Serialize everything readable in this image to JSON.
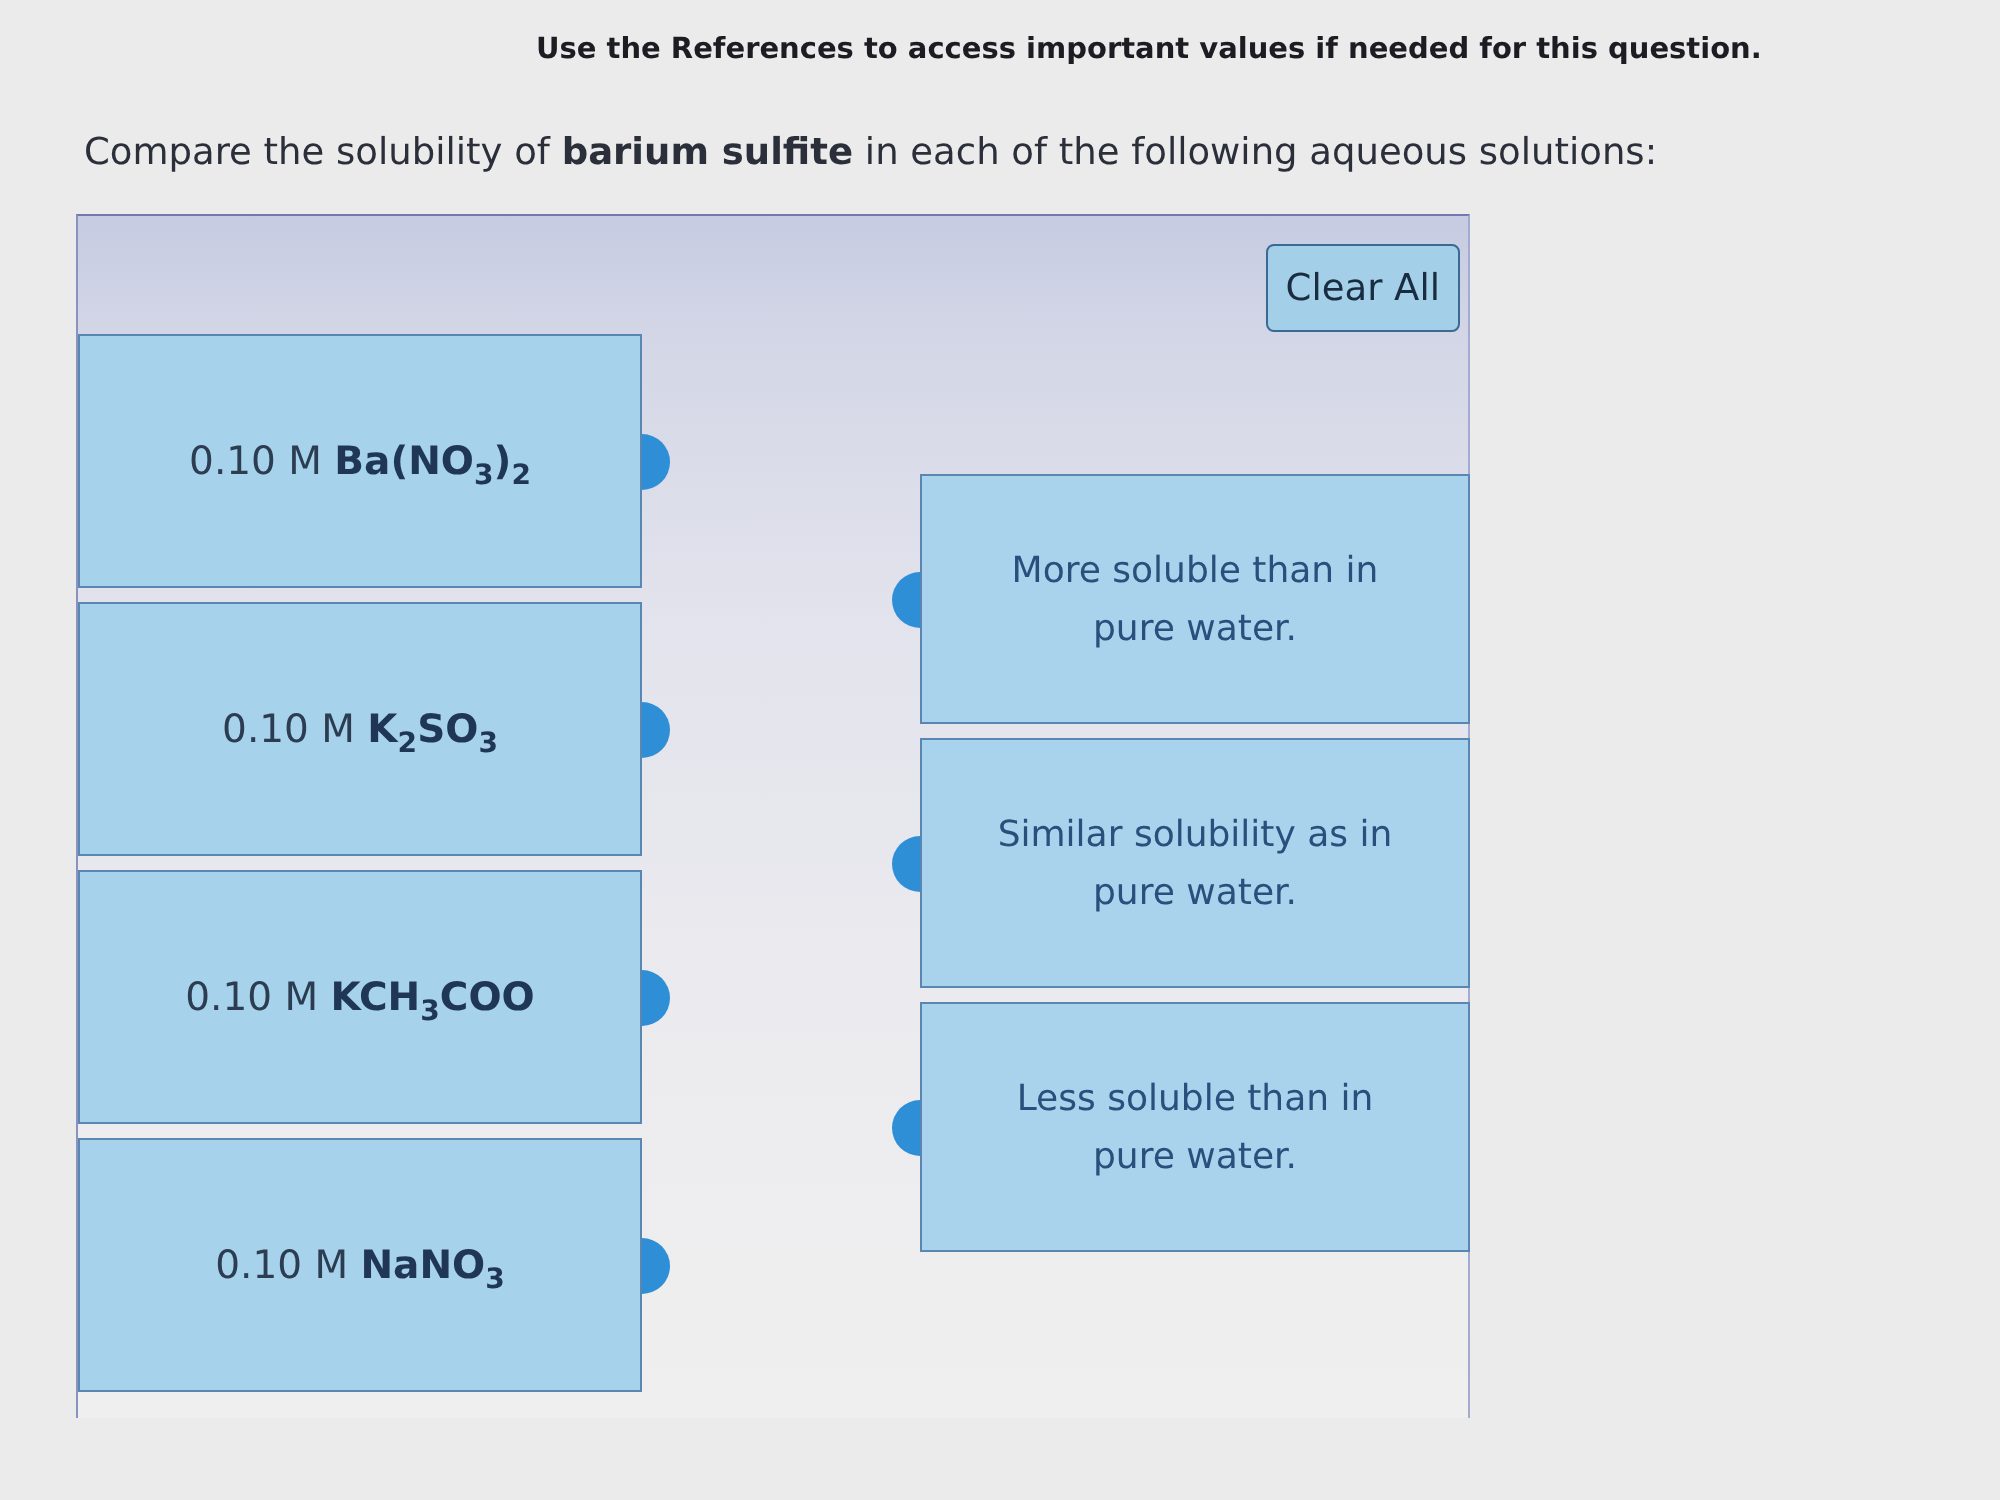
{
  "notice": "Use the References to access important values if needed for this question.",
  "question": "Compare the solubility of **barium sulfite** in each of the following aqueous solutions:",
  "panel": {
    "clear_button": "Clear All",
    "solutions": [
      {
        "label": "0.10 M **Ba(NO$_{3}$)$_{2}$**"
      },
      {
        "label": "0.10 M **K$_{2}$SO$_{3}$**"
      },
      {
        "label": "0.10 M **KCH$_{3}$COO**"
      },
      {
        "label": "0.10 M **NaNO$_{3}$**"
      }
    ],
    "categories": [
      {
        "label": "More soluble than in pure water."
      },
      {
        "label": "Similar solubility as in pure water."
      },
      {
        "label": "Less soluble than in pure water."
      }
    ]
  }
}
